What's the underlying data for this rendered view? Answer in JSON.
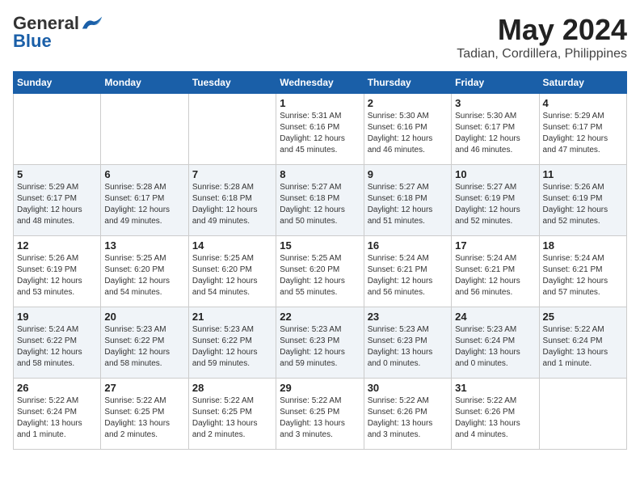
{
  "logo": {
    "general": "General",
    "blue": "Blue"
  },
  "title": {
    "month_year": "May 2024",
    "location": "Tadian, Cordillera, Philippines"
  },
  "days_of_week": [
    "Sunday",
    "Monday",
    "Tuesday",
    "Wednesday",
    "Thursday",
    "Friday",
    "Saturday"
  ],
  "weeks": [
    [
      {
        "day": "",
        "info": ""
      },
      {
        "day": "",
        "info": ""
      },
      {
        "day": "",
        "info": ""
      },
      {
        "day": "1",
        "info": "Sunrise: 5:31 AM\nSunset: 6:16 PM\nDaylight: 12 hours\nand 45 minutes."
      },
      {
        "day": "2",
        "info": "Sunrise: 5:30 AM\nSunset: 6:16 PM\nDaylight: 12 hours\nand 46 minutes."
      },
      {
        "day": "3",
        "info": "Sunrise: 5:30 AM\nSunset: 6:17 PM\nDaylight: 12 hours\nand 46 minutes."
      },
      {
        "day": "4",
        "info": "Sunrise: 5:29 AM\nSunset: 6:17 PM\nDaylight: 12 hours\nand 47 minutes."
      }
    ],
    [
      {
        "day": "5",
        "info": "Sunrise: 5:29 AM\nSunset: 6:17 PM\nDaylight: 12 hours\nand 48 minutes."
      },
      {
        "day": "6",
        "info": "Sunrise: 5:28 AM\nSunset: 6:17 PM\nDaylight: 12 hours\nand 49 minutes."
      },
      {
        "day": "7",
        "info": "Sunrise: 5:28 AM\nSunset: 6:18 PM\nDaylight: 12 hours\nand 49 minutes."
      },
      {
        "day": "8",
        "info": "Sunrise: 5:27 AM\nSunset: 6:18 PM\nDaylight: 12 hours\nand 50 minutes."
      },
      {
        "day": "9",
        "info": "Sunrise: 5:27 AM\nSunset: 6:18 PM\nDaylight: 12 hours\nand 51 minutes."
      },
      {
        "day": "10",
        "info": "Sunrise: 5:27 AM\nSunset: 6:19 PM\nDaylight: 12 hours\nand 52 minutes."
      },
      {
        "day": "11",
        "info": "Sunrise: 5:26 AM\nSunset: 6:19 PM\nDaylight: 12 hours\nand 52 minutes."
      }
    ],
    [
      {
        "day": "12",
        "info": "Sunrise: 5:26 AM\nSunset: 6:19 PM\nDaylight: 12 hours\nand 53 minutes."
      },
      {
        "day": "13",
        "info": "Sunrise: 5:25 AM\nSunset: 6:20 PM\nDaylight: 12 hours\nand 54 minutes."
      },
      {
        "day": "14",
        "info": "Sunrise: 5:25 AM\nSunset: 6:20 PM\nDaylight: 12 hours\nand 54 minutes."
      },
      {
        "day": "15",
        "info": "Sunrise: 5:25 AM\nSunset: 6:20 PM\nDaylight: 12 hours\nand 55 minutes."
      },
      {
        "day": "16",
        "info": "Sunrise: 5:24 AM\nSunset: 6:21 PM\nDaylight: 12 hours\nand 56 minutes."
      },
      {
        "day": "17",
        "info": "Sunrise: 5:24 AM\nSunset: 6:21 PM\nDaylight: 12 hours\nand 56 minutes."
      },
      {
        "day": "18",
        "info": "Sunrise: 5:24 AM\nSunset: 6:21 PM\nDaylight: 12 hours\nand 57 minutes."
      }
    ],
    [
      {
        "day": "19",
        "info": "Sunrise: 5:24 AM\nSunset: 6:22 PM\nDaylight: 12 hours\nand 58 minutes."
      },
      {
        "day": "20",
        "info": "Sunrise: 5:23 AM\nSunset: 6:22 PM\nDaylight: 12 hours\nand 58 minutes."
      },
      {
        "day": "21",
        "info": "Sunrise: 5:23 AM\nSunset: 6:22 PM\nDaylight: 12 hours\nand 59 minutes."
      },
      {
        "day": "22",
        "info": "Sunrise: 5:23 AM\nSunset: 6:23 PM\nDaylight: 12 hours\nand 59 minutes."
      },
      {
        "day": "23",
        "info": "Sunrise: 5:23 AM\nSunset: 6:23 PM\nDaylight: 13 hours\nand 0 minutes."
      },
      {
        "day": "24",
        "info": "Sunrise: 5:23 AM\nSunset: 6:24 PM\nDaylight: 13 hours\nand 0 minutes."
      },
      {
        "day": "25",
        "info": "Sunrise: 5:22 AM\nSunset: 6:24 PM\nDaylight: 13 hours\nand 1 minute."
      }
    ],
    [
      {
        "day": "26",
        "info": "Sunrise: 5:22 AM\nSunset: 6:24 PM\nDaylight: 13 hours\nand 1 minute."
      },
      {
        "day": "27",
        "info": "Sunrise: 5:22 AM\nSunset: 6:25 PM\nDaylight: 13 hours\nand 2 minutes."
      },
      {
        "day": "28",
        "info": "Sunrise: 5:22 AM\nSunset: 6:25 PM\nDaylight: 13 hours\nand 2 minutes."
      },
      {
        "day": "29",
        "info": "Sunrise: 5:22 AM\nSunset: 6:25 PM\nDaylight: 13 hours\nand 3 minutes."
      },
      {
        "day": "30",
        "info": "Sunrise: 5:22 AM\nSunset: 6:26 PM\nDaylight: 13 hours\nand 3 minutes."
      },
      {
        "day": "31",
        "info": "Sunrise: 5:22 AM\nSunset: 6:26 PM\nDaylight: 13 hours\nand 4 minutes."
      },
      {
        "day": "",
        "info": ""
      }
    ]
  ]
}
